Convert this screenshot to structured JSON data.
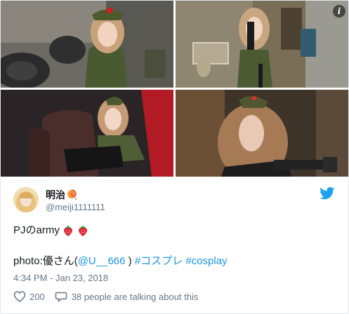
{
  "tweet": {
    "display_name": "明治",
    "handle": "@meiji1111111",
    "text": "PJのarmy",
    "credit_prefix": "photo:優さん(",
    "credit_mention": "@U__666",
    "credit_mid": " ) ",
    "hashtag1": "#コスプレ",
    "hashtag2": "#cosplay",
    "timestamp": "4:34 PM - Jan 23, 2018",
    "like_count": "200",
    "talking_text": "38 people are talking about this"
  },
  "icons": {
    "info": "info-icon",
    "bird": "twitter-bird-icon",
    "heart": "heart-icon",
    "comment": "comment-icon",
    "lollipop": "lollipop-icon",
    "strawberry": "strawberry-icon"
  },
  "colors": {
    "link": "#1b95e0",
    "twitter_blue": "#1da1f2",
    "muted": "#657786"
  }
}
